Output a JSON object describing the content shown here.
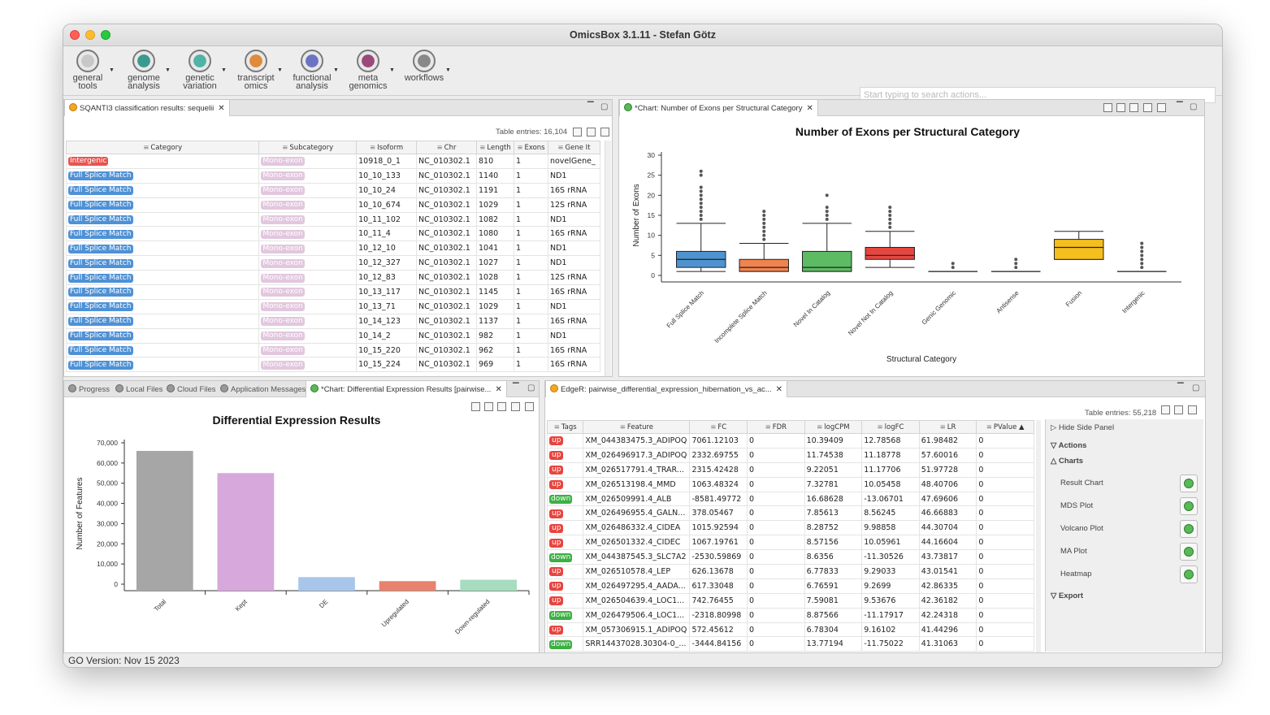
{
  "window": {
    "title": "OmicsBox 3.1.11 - Stefan Götz"
  },
  "toolbar": {
    "items": [
      {
        "label": "general\ntools",
        "color": "#c8c8c8"
      },
      {
        "label": "genome\nanalysis",
        "color": "#3a9a8e"
      },
      {
        "label": "genetic\nvariation",
        "color": "#4fb3a6"
      },
      {
        "label": "transcript\nomics",
        "color": "#e08a3c"
      },
      {
        "label": "functional\nanalysis",
        "color": "#6b74c4"
      },
      {
        "label": "meta\ngenomics",
        "color": "#9a4a79"
      },
      {
        "label": "workflows",
        "color": "#888888"
      }
    ],
    "search_placeholder": "Start typing to search actions..."
  },
  "sqanti": {
    "tab_label": "SQANTI3 classification results: sequelii",
    "entries": "Table entries: 16,104",
    "columns": [
      "Category",
      "Subcategory",
      "Isoform",
      "Chr",
      "Length",
      "Exons",
      "Gene It"
    ],
    "rows": [
      [
        "Intergenic",
        "Mono-exon",
        "10918_0_1",
        "NC_010302.1",
        "810",
        "1",
        "novelGene_"
      ],
      [
        "Full Splice Match",
        "Mono-exon",
        "10_10_133",
        "NC_010302.1",
        "1140",
        "1",
        "ND1"
      ],
      [
        "Full Splice Match",
        "Mono-exon",
        "10_10_24",
        "NC_010302.1",
        "1191",
        "1",
        "16S rRNA"
      ],
      [
        "Full Splice Match",
        "Mono-exon",
        "10_10_674",
        "NC_010302.1",
        "1029",
        "1",
        "12S rRNA"
      ],
      [
        "Full Splice Match",
        "Mono-exon",
        "10_11_102",
        "NC_010302.1",
        "1082",
        "1",
        "ND1"
      ],
      [
        "Full Splice Match",
        "Mono-exon",
        "10_11_4",
        "NC_010302.1",
        "1080",
        "1",
        "16S rRNA"
      ],
      [
        "Full Splice Match",
        "Mono-exon",
        "10_12_10",
        "NC_010302.1",
        "1041",
        "1",
        "ND1"
      ],
      [
        "Full Splice Match",
        "Mono-exon",
        "10_12_327",
        "NC_010302.1",
        "1027",
        "1",
        "ND1"
      ],
      [
        "Full Splice Match",
        "Mono-exon",
        "10_12_83",
        "NC_010302.1",
        "1028",
        "1",
        "12S rRNA"
      ],
      [
        "Full Splice Match",
        "Mono-exon",
        "10_13_117",
        "NC_010302.1",
        "1145",
        "1",
        "16S rRNA"
      ],
      [
        "Full Splice Match",
        "Mono-exon",
        "10_13_71",
        "NC_010302.1",
        "1029",
        "1",
        "ND1"
      ],
      [
        "Full Splice Match",
        "Mono-exon",
        "10_14_123",
        "NC_010302.1",
        "1137",
        "1",
        "16S rRNA"
      ],
      [
        "Full Splice Match",
        "Mono-exon",
        "10_14_2",
        "NC_010302.1",
        "982",
        "1",
        "ND1"
      ],
      [
        "Full Splice Match",
        "Mono-exon",
        "10_15_220",
        "NC_010302.1",
        "962",
        "1",
        "16S rRNA"
      ],
      [
        "Full Splice Match",
        "Mono-exon",
        "10_15_224",
        "NC_010302.1",
        "969",
        "1",
        "16S rRNA"
      ]
    ]
  },
  "exons_chart_tab": "*Chart: Number of Exons per Structural Category",
  "bottom_tabs": [
    "Progress",
    "Local Files",
    "Cloud Files",
    "Application Messages",
    "*Chart: Differential Expression Results [pairwise..."
  ],
  "edger": {
    "tab_label": "EdgeR: pairwise_differential_expression_hibernation_vs_ac...",
    "entries": "Table entries: 55,218",
    "columns": [
      "Tags",
      "Feature",
      "FC",
      "FDR",
      "logCPM",
      "logFC",
      "LR",
      "PValue ▲"
    ],
    "rows": [
      [
        "up",
        "XM_044383475.3_ADIPOQ",
        "7061.12103",
        "0",
        "10.39409",
        "12.78568",
        "61.98482",
        "0"
      ],
      [
        "up",
        "XM_026496917.3_ADIPOQ",
        "2332.69755",
        "0",
        "11.74538",
        "11.18778",
        "57.60016",
        "0"
      ],
      [
        "up",
        "XM_026517791.4_TRAR...",
        "2315.42428",
        "0",
        "9.22051",
        "11.17706",
        "51.97728",
        "0"
      ],
      [
        "up",
        "XM_026513198.4_MMD",
        "1063.48324",
        "0",
        "7.32781",
        "10.05458",
        "48.40706",
        "0"
      ],
      [
        "down",
        "XM_026509991.4_ALB",
        "-8581.49772",
        "0",
        "16.68628",
        "-13.06701",
        "47.69606",
        "0"
      ],
      [
        "up",
        "XM_026496955.4_GALN...",
        "378.05467",
        "0",
        "7.85613",
        "8.56245",
        "46.66883",
        "0"
      ],
      [
        "up",
        "XM_026486332.4_CIDEA",
        "1015.92594",
        "0",
        "8.28752",
        "9.98858",
        "44.30704",
        "0"
      ],
      [
        "up",
        "XM_026501332.4_CIDEC",
        "1067.19761",
        "0",
        "8.57156",
        "10.05961",
        "44.16604",
        "0"
      ],
      [
        "down",
        "XM_044387545.3_SLC7A2",
        "-2530.59869",
        "0",
        "8.6356",
        "-11.30526",
        "43.73817",
        "0"
      ],
      [
        "up",
        "XM_026510578.4_LEP",
        "626.13678",
        "0",
        "6.77833",
        "9.29033",
        "43.01541",
        "0"
      ],
      [
        "up",
        "XM_026497295.4_AADA...",
        "617.33048",
        "0",
        "6.76591",
        "9.2699",
        "42.86335",
        "0"
      ],
      [
        "up",
        "XM_026504639.4_LOC1...",
        "742.76455",
        "0",
        "7.59081",
        "9.53676",
        "42.36182",
        "0"
      ],
      [
        "down",
        "XM_026479506.4_LOC1...",
        "-2318.80998",
        "0",
        "8.87566",
        "-11.17917",
        "42.24318",
        "0"
      ],
      [
        "up",
        "XM_057306915.1_ADIPOQ",
        "572.45612",
        "0",
        "6.78304",
        "9.16102",
        "41.44296",
        "0"
      ],
      [
        "down",
        "SRR14437028.30304-0_...",
        "-3444.84156",
        "0",
        "13.77194",
        "-11.75022",
        "41.31063",
        "0"
      ]
    ]
  },
  "side_panel": {
    "hide": "Hide Side Panel",
    "actions": "Actions",
    "charts": "Charts",
    "chart_items": [
      "Result Chart",
      "MDS Plot",
      "Volcano Plot",
      "MA Plot",
      "Heatmap"
    ],
    "export": "Export"
  },
  "status": "GO Version: Nov 15 2023",
  "chart_data": [
    {
      "type": "box",
      "title": "Number of Exons per Structural Category",
      "xlabel": "Structural Category",
      "ylabel": "Number of Exons",
      "ylim": [
        0,
        30
      ],
      "yticks": [
        0,
        5,
        10,
        15,
        20,
        25,
        30
      ],
      "series": [
        {
          "name": "Full Splice Match",
          "color": "#4e93cf",
          "whisker_low": 1,
          "q1": 2,
          "median": 4,
          "q3": 6,
          "whisker_high": 13,
          "outliers": [
            14,
            15,
            16,
            17,
            18,
            19,
            20,
            21,
            22,
            25,
            26
          ]
        },
        {
          "name": "Incomplete Splice Match",
          "color": "#f0834e",
          "whisker_low": 1,
          "q1": 1,
          "median": 2,
          "q3": 4,
          "whisker_high": 8,
          "outliers": [
            9,
            10,
            11,
            12,
            13,
            14,
            15,
            16
          ]
        },
        {
          "name": "Novel In Catalog",
          "color": "#5dbb63",
          "whisker_low": 1,
          "q1": 1,
          "median": 2,
          "q3": 6,
          "whisker_high": 13,
          "outliers": [
            14,
            15,
            16,
            17,
            20
          ]
        },
        {
          "name": "Novel Not In Catalog",
          "color": "#e5463f",
          "whisker_low": 2,
          "q1": 4,
          "median": 5,
          "q3": 7,
          "whisker_high": 11,
          "outliers": [
            12,
            13,
            14,
            15,
            16,
            17
          ]
        },
        {
          "name": "Genic Genomic",
          "color": "#4e93cf",
          "whisker_low": 1,
          "q1": 1,
          "median": 1,
          "q3": 1,
          "whisker_high": 1,
          "outliers": [
            2,
            3
          ]
        },
        {
          "name": "Antisense",
          "color": "#4e93cf",
          "whisker_low": 1,
          "q1": 1,
          "median": 1,
          "q3": 1,
          "whisker_high": 1,
          "outliers": [
            2,
            3,
            4
          ]
        },
        {
          "name": "Fusion",
          "color": "#f5c01d",
          "whisker_low": 4,
          "q1": 4,
          "median": 7,
          "q3": 9,
          "whisker_high": 11,
          "outliers": []
        },
        {
          "name": "Intergenic",
          "color": "#4e93cf",
          "whisker_low": 1,
          "q1": 1,
          "median": 1,
          "q3": 1,
          "whisker_high": 1,
          "outliers": [
            2,
            3,
            4,
            5,
            6,
            7,
            8
          ]
        }
      ]
    },
    {
      "type": "bar",
      "title": "Differential Expression Results",
      "ylabel": "Number of Features",
      "ylim": [
        0,
        70000
      ],
      "yticks": [
        0,
        10000,
        20000,
        30000,
        40000,
        50000,
        60000,
        70000
      ],
      "ytick_labels": [
        "0",
        "10,000",
        "20,000",
        "30,000",
        "40,000",
        "50,000",
        "60,000",
        "70,000"
      ],
      "categories": [
        "Total",
        "Kept",
        "DE",
        "Upregulated",
        "Down-regulated"
      ],
      "values": [
        66000,
        55000,
        3500,
        1500,
        2200
      ],
      "colors": [
        "#a6a6a6",
        "#d7a8dc",
        "#a9c6ea",
        "#e8826e",
        "#a6dcc0"
      ]
    }
  ]
}
